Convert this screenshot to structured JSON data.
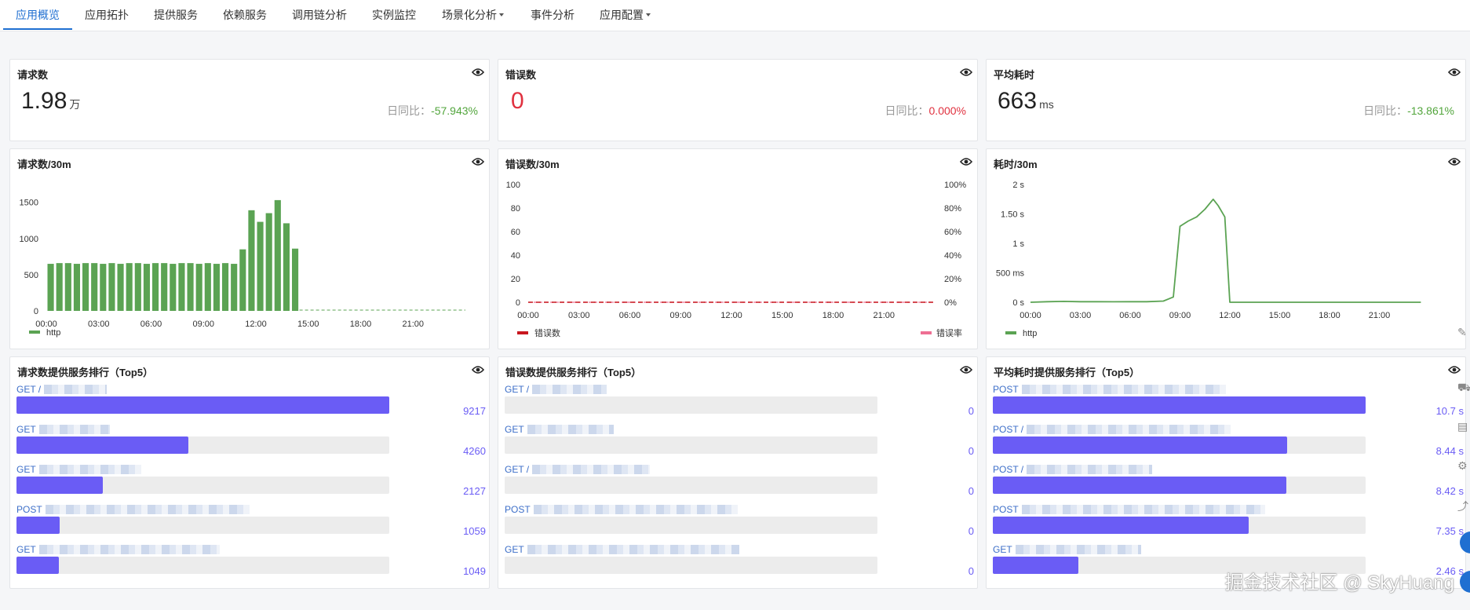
{
  "nav": {
    "tabs": [
      "应用概览",
      "应用拓扑",
      "提供服务",
      "依赖服务",
      "调用链分析",
      "实例监控",
      "场景化分析",
      "事件分析",
      "应用配置"
    ],
    "active": "应用概览"
  },
  "kpi": {
    "requests": {
      "title": "请求数",
      "value": "1.98",
      "unit": "万",
      "compare_label": "日同比：",
      "compare_value": "-57.943%"
    },
    "errors": {
      "title": "错误数",
      "value": "0",
      "unit": "",
      "compare_label": "日同比：",
      "compare_value": "0.000%"
    },
    "latency": {
      "title": "平均耗时",
      "value": "663",
      "unit": "ms",
      "compare_label": "日同比：",
      "compare_value": "-13.861%"
    }
  },
  "charts": {
    "requests": {
      "title": "请求数/30m",
      "legend": "http"
    },
    "errors": {
      "title": "错误数/30m",
      "legend_left": "错误数",
      "legend_right": "错误率"
    },
    "latency": {
      "title": "耗时/30m",
      "legend": "http"
    }
  },
  "chart_data": [
    {
      "type": "bar",
      "title": "请求数/30m",
      "x_ticks": [
        "00:00",
        "03:00",
        "06:00",
        "09:00",
        "12:00",
        "15:00",
        "18:00",
        "21:00"
      ],
      "y_ticks": [
        "0",
        "500",
        "1000",
        "1500"
      ],
      "ylim": [
        0,
        1800
      ],
      "series": [
        {
          "name": "http",
          "values": [
            650,
            660,
            660,
            650,
            660,
            660,
            650,
            660,
            650,
            660,
            660,
            650,
            660,
            660,
            650,
            660,
            660,
            650,
            660,
            650,
            660,
            650,
            850,
            1390,
            1230,
            1350,
            1530,
            1210,
            860
          ]
        }
      ],
      "slots": 48,
      "color": "#5ba353"
    },
    {
      "type": "line",
      "title": "错误数/30m",
      "x_ticks": [
        "00:00",
        "03:00",
        "06:00",
        "09:00",
        "12:00",
        "15:00",
        "18:00",
        "21:00"
      ],
      "y_ticks": [
        "0",
        "20",
        "40",
        "60",
        "80",
        "100"
      ],
      "y2_ticks": [
        "0%",
        "20%",
        "40%",
        "60%",
        "80%",
        "100%"
      ],
      "ylim": [
        0,
        100
      ],
      "series": [
        {
          "name": "错误数",
          "value": 0,
          "color": "#c8171f"
        },
        {
          "name": "错误率",
          "value": 0,
          "color": "#ee6f93"
        }
      ]
    },
    {
      "type": "line",
      "title": "耗时/30m",
      "x_ticks": [
        "00:00",
        "03:00",
        "06:00",
        "09:00",
        "12:00",
        "15:00",
        "18:00",
        "21:00"
      ],
      "y_ticks": [
        "0 s",
        "500 ms",
        "1 s",
        "1.50 s",
        "2 s"
      ],
      "ylim_ms": [
        0,
        2000
      ],
      "series": [
        {
          "name": "http",
          "points_hours_ms": [
            [
              0,
              0
            ],
            [
              1,
              10
            ],
            [
              2,
              15
            ],
            [
              3,
              10
            ],
            [
              4,
              10
            ],
            [
              5,
              8
            ],
            [
              6,
              10
            ],
            [
              7,
              10
            ],
            [
              8,
              20
            ],
            [
              8.6,
              90
            ],
            [
              9,
              1290
            ],
            [
              9.5,
              1380
            ],
            [
              10,
              1450
            ],
            [
              10.5,
              1580
            ],
            [
              11,
              1750
            ],
            [
              11.3,
              1640
            ],
            [
              11.7,
              1450
            ],
            [
              12,
              0
            ],
            [
              13,
              0
            ],
            [
              15,
              0
            ],
            [
              18,
              0
            ],
            [
              21,
              0
            ],
            [
              23.5,
              0
            ]
          ]
        }
      ],
      "color": "#5ba353"
    }
  ],
  "rankings": {
    "requests": {
      "title": "请求数提供服务排行（Top5）",
      "items": [
        {
          "method": "GET /",
          "value": "9217",
          "fraction": 1.0
        },
        {
          "method": "GET",
          "value": "4260",
          "fraction": 0.462
        },
        {
          "method": "GET",
          "value": "2127",
          "fraction": 0.231
        },
        {
          "method": "POST",
          "value": "1059",
          "fraction": 0.115
        },
        {
          "method": "GET",
          "value": "1049",
          "fraction": 0.114
        }
      ]
    },
    "errors": {
      "title": "错误数提供服务排行（Top5）",
      "items": [
        {
          "method": "GET /",
          "value": "0",
          "fraction": 0
        },
        {
          "method": "GET",
          "value": "0",
          "fraction": 0
        },
        {
          "method": "GET /",
          "value": "0",
          "fraction": 0
        },
        {
          "method": "POST",
          "value": "0",
          "fraction": 0
        },
        {
          "method": "GET",
          "value": "0",
          "fraction": 0
        }
      ]
    },
    "latency": {
      "title": "平均耗时提供服务排行（Top5）",
      "items": [
        {
          "method": "POST",
          "value": "10.7 s",
          "fraction": 1.0
        },
        {
          "method": "POST /",
          "value": "8.44 s",
          "fraction": 0.789
        },
        {
          "method": "POST /",
          "value": "8.42 s",
          "fraction": 0.787
        },
        {
          "method": "POST",
          "value": "7.35 s",
          "fraction": 0.687
        },
        {
          "method": "GET",
          "value": "2.46 s",
          "fraction": 0.23
        }
      ]
    }
  },
  "watermark": "掘金技术社区 @ SkyHuang"
}
